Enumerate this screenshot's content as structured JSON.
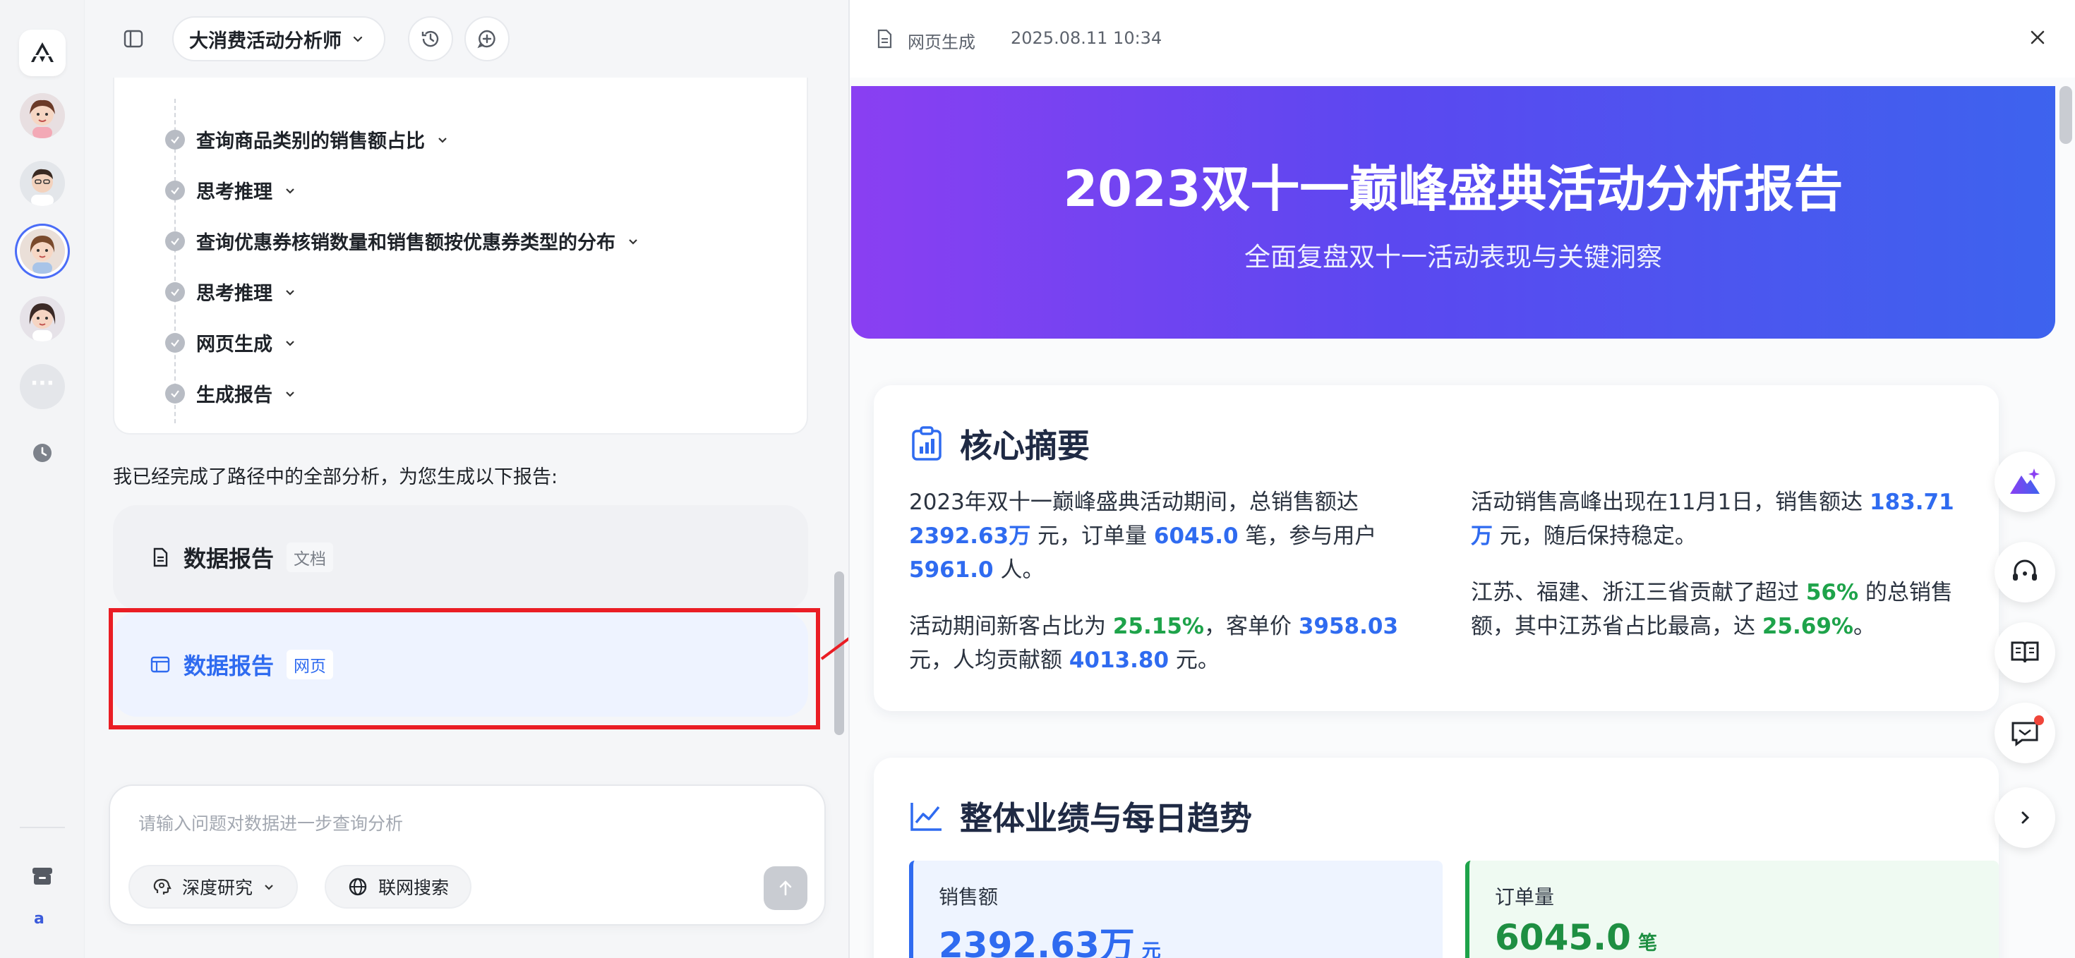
{
  "header": {
    "agent_name": "大消费活动分析师"
  },
  "steps": [
    {
      "label": "查询商品类别的销售额占比"
    },
    {
      "label": "思考推理"
    },
    {
      "label": "查询优惠券核销数量和销售额按优惠券类型的分布"
    },
    {
      "label": "思考推理"
    },
    {
      "label": "网页生成"
    },
    {
      "label": "生成报告"
    }
  ],
  "message": "我已经完成了路径中的全部分析，为您生成以下报告:",
  "reports": [
    {
      "title": "数据报告",
      "tag": "文档"
    },
    {
      "title": "数据报告",
      "tag": "网页"
    }
  ],
  "composer": {
    "placeholder": "请输入问题对数据进一步查询分析",
    "deep_research": "深度研究",
    "web_search": "联网搜索"
  },
  "rail": {
    "user_letter": "a"
  },
  "panel": {
    "type": "网页生成",
    "time": "2025.08.11 10:34"
  },
  "report": {
    "title": "2023双十一巅峰盛典活动分析报告",
    "subtitle": "全面复盘双十一活动表现与关键洞察",
    "summary_title": "核心摘要",
    "p1": {
      "a": "2023年双十一巅峰盛典活动期间，总销售额达 ",
      "sales": "2392.63万",
      "b": " 元，订单量 ",
      "orders": "6045.0",
      "c": " 笔，参与用户 ",
      "users": "5961.0",
      "d": " 人。"
    },
    "p2": {
      "a": "活动期间新客占比为 ",
      "new_ratio": "25.15%",
      "b": "，客单价 ",
      "aov": "3958.03",
      "c": " 元，人均贡献额 ",
      "per_user": "4013.80",
      "d": " 元。"
    },
    "p3": {
      "a": "活动销售高峰出现在11月1日，销售额达 ",
      "peak": "183.71万",
      "b": " 元，随后保持稳定。"
    },
    "p4": {
      "a": "江苏、福建、浙江三省贡献了超过 ",
      "share": "56%",
      "b": " 的总销售额，其中江苏省占比最高，达 ",
      "js": "25.69%",
      "c": "。"
    },
    "perf_title": "整体业绩与每日趋势",
    "kpis": [
      {
        "label": "销售额",
        "value": "2392.63万",
        "unit": "元"
      },
      {
        "label": "订单量",
        "value": "6045.0",
        "unit": "笔"
      }
    ]
  },
  "colors": {
    "accent_blue": "#2f6bf0",
    "accent_green": "#1ea34a",
    "highlight_red": "#ea1d24",
    "hero_start": "#8a3ff2",
    "hero_end": "#3d63ee"
  }
}
